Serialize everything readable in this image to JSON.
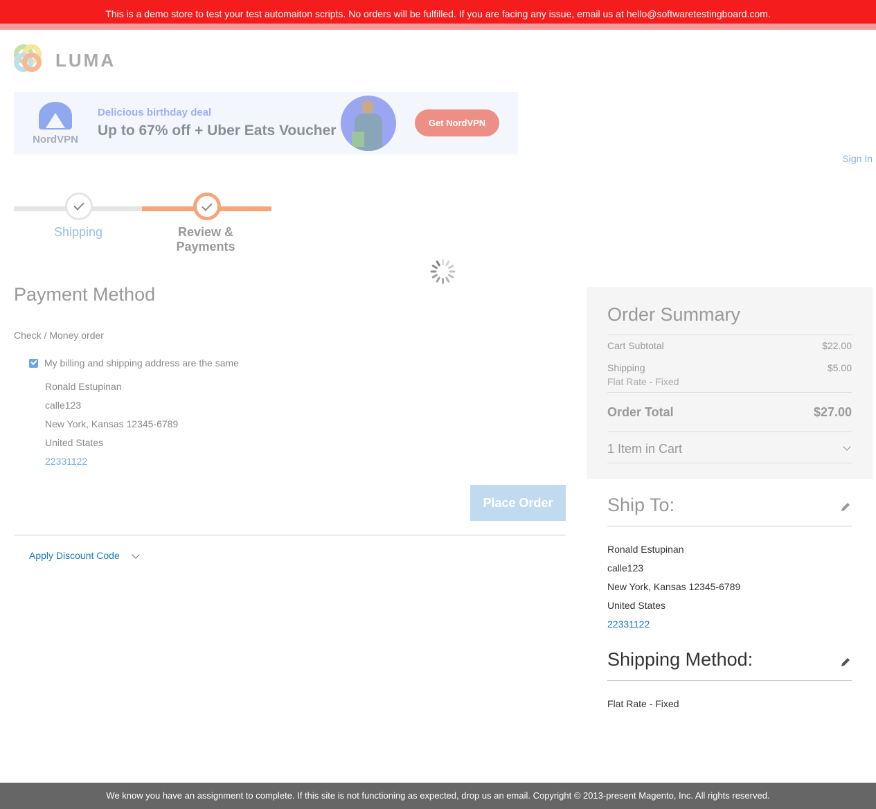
{
  "demo_banner": "This is a demo store to test your test automaiton scripts. No orders will be fulfilled. If you are facing any issue, email us at hello@softwaretestingboard.com.",
  "logo": {
    "text": "LUMA",
    "colors": [
      "#f6d047",
      "#f17f45",
      "#8ac4e5",
      "#94c96a"
    ]
  },
  "ad": {
    "brand": "NordVPN",
    "kicker": "Delicious birthday deal",
    "headline": "Up to 67% off + Uber Eats Voucher",
    "cta": "Get NordVPN"
  },
  "header": {
    "sign_in": "Sign In"
  },
  "progress": {
    "steps": [
      {
        "label": "Shipping"
      },
      {
        "label": "Review & Payments"
      }
    ]
  },
  "payment": {
    "title": "Payment Method",
    "method": "Check / Money order",
    "same_address_label": "My billing and shipping address are the same",
    "same_address_checked": true,
    "address": {
      "name": "Ronald Estupinan",
      "street": "calle123",
      "city_line": "New York, Kansas 12345-6789",
      "country": "United States",
      "phone": "22331122"
    },
    "place_order": "Place Order",
    "discount_label": "Apply Discount Code"
  },
  "order_summary": {
    "title": "Order Summary",
    "subtotal_label": "Cart Subtotal",
    "subtotal_value": "$22.00",
    "shipping_label": "Shipping",
    "shipping_value": "$5.00",
    "shipping_method": "Flat Rate - Fixed",
    "total_label": "Order Total",
    "total_value": "$27.00",
    "items_in_cart": "1 Item in Cart"
  },
  "ship_to": {
    "title": "Ship To:",
    "name": "Ronald Estupinan",
    "street": "calle123",
    "city_line": "New York, Kansas 12345-6789",
    "country": "United States",
    "phone": "22331122"
  },
  "shipping_method": {
    "title": "Shipping Method:",
    "value": "Flat Rate - Fixed"
  },
  "footer": "We know you have an assignment to complete. If this site is not functioning as expected, drop us an email. Copyright © 2013-present Magento, Inc. All rights reserved."
}
